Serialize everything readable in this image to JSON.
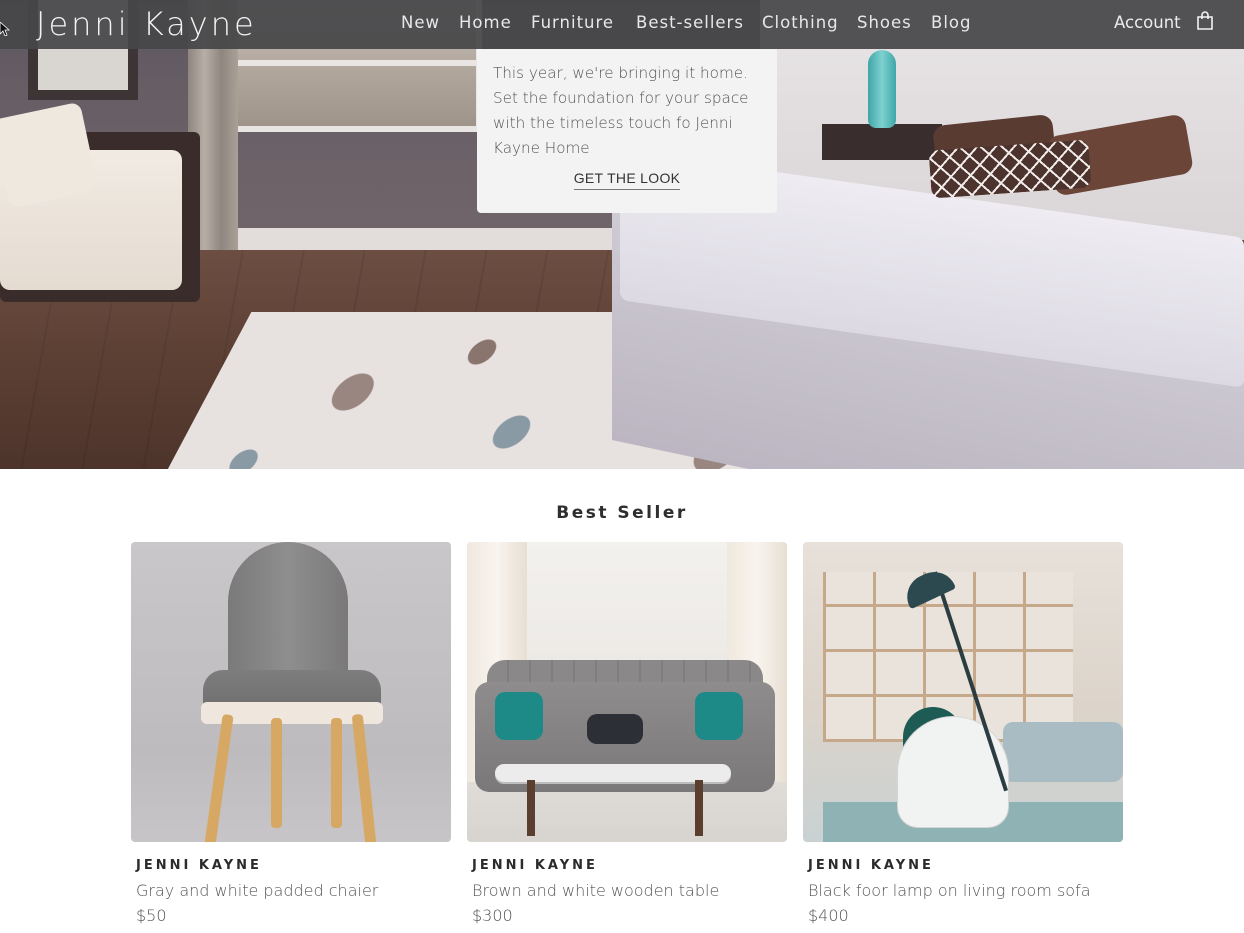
{
  "header": {
    "brand": "Jenni Kayne",
    "nav": [
      "New",
      "Home",
      "Furniture",
      "Best-sellers",
      "Clothing",
      "Shoes",
      "Blog"
    ],
    "account_label": "Account",
    "cart_icon": "shopping-bag-icon"
  },
  "promo": {
    "text": "This year, we're bringing it home. Set the foundation for your space with the timeless touch fo Jenni Kayne Home",
    "cta_label": "GET THE LOOK"
  },
  "best_seller": {
    "title": "Best Seller",
    "products": [
      {
        "brand": "JENNI KAYNE",
        "title": "Gray and white padded chaier",
        "price": "$50"
      },
      {
        "brand": "JENNI KAYNE",
        "title": "Brown and white wooden table",
        "price": "$300"
      },
      {
        "brand": "JENNI KAYNE",
        "title": "Black foor lamp on living room sofa",
        "price": "$400"
      }
    ]
  },
  "colors": {
    "nav_background": "#464648",
    "promo_background": "#f3f3f3",
    "text_dark": "#2e2e2e"
  }
}
